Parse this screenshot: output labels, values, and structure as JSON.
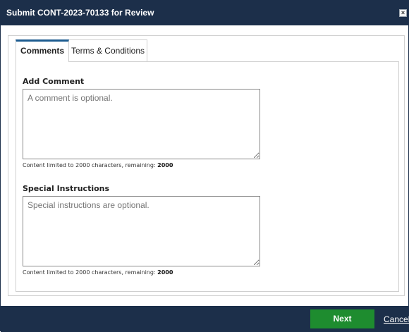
{
  "dialog": {
    "title": "Submit CONT-2023-70133 for Review",
    "close_symbol": "×"
  },
  "tabs": [
    {
      "label": "Comments",
      "active": true
    },
    {
      "label": "Terms & Conditions",
      "active": false
    }
  ],
  "comment": {
    "label": "Add Comment",
    "placeholder": "A comment is optional.",
    "value": "",
    "limit_prefix": "Content limited to 2000 characters, remaining: ",
    "remaining": "2000"
  },
  "instructions": {
    "label": "Special Instructions",
    "placeholder": "Special instructions are optional.",
    "value": "",
    "limit_prefix": "Content limited to 2000 characters, remaining: ",
    "remaining": "2000"
  },
  "footer": {
    "next_label": "Next",
    "cancel_label": "Cancel"
  },
  "colors": {
    "header_bg": "#1c2f4a",
    "next_bg": "#1e8c2f",
    "active_tab_accent": "#1c5b8f"
  },
  "icons": {
    "close": "close-icon"
  }
}
